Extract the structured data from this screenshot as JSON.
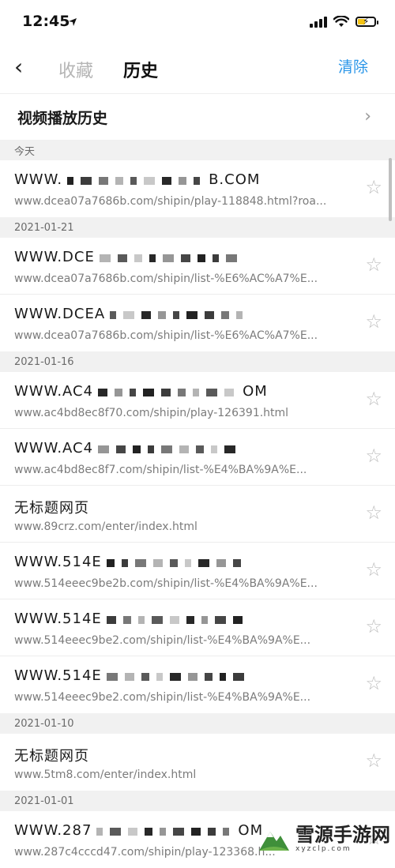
{
  "status": {
    "time": "12:45"
  },
  "nav": {
    "back_glyph": "‹",
    "tab_favorites": "收藏",
    "tab_history": "历史",
    "clear": "清除"
  },
  "video_history": {
    "label": "视频播放历史"
  },
  "groups": [
    {
      "date": "今天",
      "rows": [
        {
          "title": "WWW.",
          "title_tail": "B.COM",
          "url": "www.dcea07a7686b.com/shipin/play-118848.html?roa..."
        }
      ]
    },
    {
      "date": "2021-01-21",
      "rows": [
        {
          "title": "WWW.DCE",
          "title_tail": "",
          "url": "www.dcea07a7686b.com/shipin/list-%E6%AC%A7%E..."
        },
        {
          "title": "WWW.DCEA",
          "title_tail": "",
          "url": "www.dcea07a7686b.com/shipin/list-%E6%AC%A7%E..."
        }
      ]
    },
    {
      "date": "2021-01-16",
      "rows": [
        {
          "title": "WWW.AC4",
          "title_tail": "OM",
          "url": "www.ac4bd8ec8f70.com/shipin/play-126391.html"
        },
        {
          "title": "WWW.AC4",
          "title_tail": "",
          "url": "www.ac4bd8ec8f7.com/shipin/list-%E4%BA%9A%E..."
        },
        {
          "title": "无标题网页",
          "title_tail": "",
          "url": "www.89crz.com/enter/index.html"
        },
        {
          "title": "WWW.514E",
          "title_tail": "",
          "url": "www.514eeec9be2b.com/shipin/list-%E4%BA%9A%E..."
        },
        {
          "title": "WWW.514E",
          "title_tail": "",
          "url": "www.514eeec9be2.com/shipin/list-%E4%BA%9A%E..."
        },
        {
          "title": "WWW.514E",
          "title_tail": "",
          "url": "www.514eeec9be2.com/shipin/list-%E4%BA%9A%E..."
        }
      ]
    },
    {
      "date": "2021-01-10",
      "rows": [
        {
          "title": "无标题网页",
          "title_tail": "",
          "url": "www.5tm8.com/enter/index.html"
        }
      ]
    },
    {
      "date": "2021-01-01",
      "rows": [
        {
          "title": "WWW.287",
          "title_tail": "OM",
          "url": "www.287c4cccd47.com/shipin/play-123368.h..."
        }
      ]
    }
  ],
  "watermark": {
    "name": "雪源手游网",
    "domain": "xyzclp.com"
  },
  "icons": {
    "star": "star-outline-icon",
    "chevron": "chevron-right-icon",
    "back": "back-arrow-icon"
  },
  "colors": {
    "accent": "#2b96e8",
    "muted_tab": "#b5b5b5",
    "group_bg": "#f1f1f1"
  }
}
